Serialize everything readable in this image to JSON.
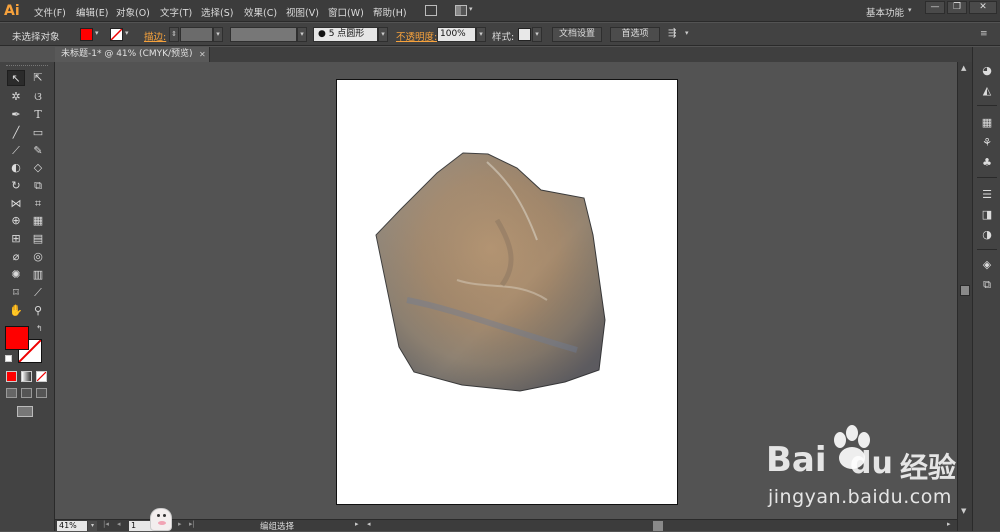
{
  "app": {
    "logo": "Ai"
  },
  "menu": {
    "items": [
      "文件(F)",
      "编辑(E)",
      "对象(O)",
      "文字(T)",
      "选择(S)",
      "效果(C)",
      "视图(V)",
      "窗口(W)",
      "帮助(H)"
    ],
    "workspace": "基本功能",
    "win_min": "—",
    "win_max": "❐",
    "win_close": "✕"
  },
  "control": {
    "selection_label": "未选择对象",
    "stroke_label": "描边:",
    "brush_value": "5 点圆形",
    "opacity_label": "不透明度:",
    "opacity_value": "100%",
    "style_label": "样式:",
    "doc_setup_button": "文档设置",
    "prefs_button": "首选项",
    "fill_color": "#ff0000"
  },
  "document": {
    "tab_title": "未标题-1* @ 41% (CMYK/预览)",
    "tab_close": "✕"
  },
  "status": {
    "zoom": "41%",
    "page": "1",
    "info": "编组选择"
  },
  "watermark": {
    "brand_left": "Bai",
    "brand_right": "du",
    "brand_cn": "经验",
    "url": "jingyan.baidu.com"
  },
  "colors": {
    "fill": "#ff0000",
    "accent": "#f7a23c"
  }
}
